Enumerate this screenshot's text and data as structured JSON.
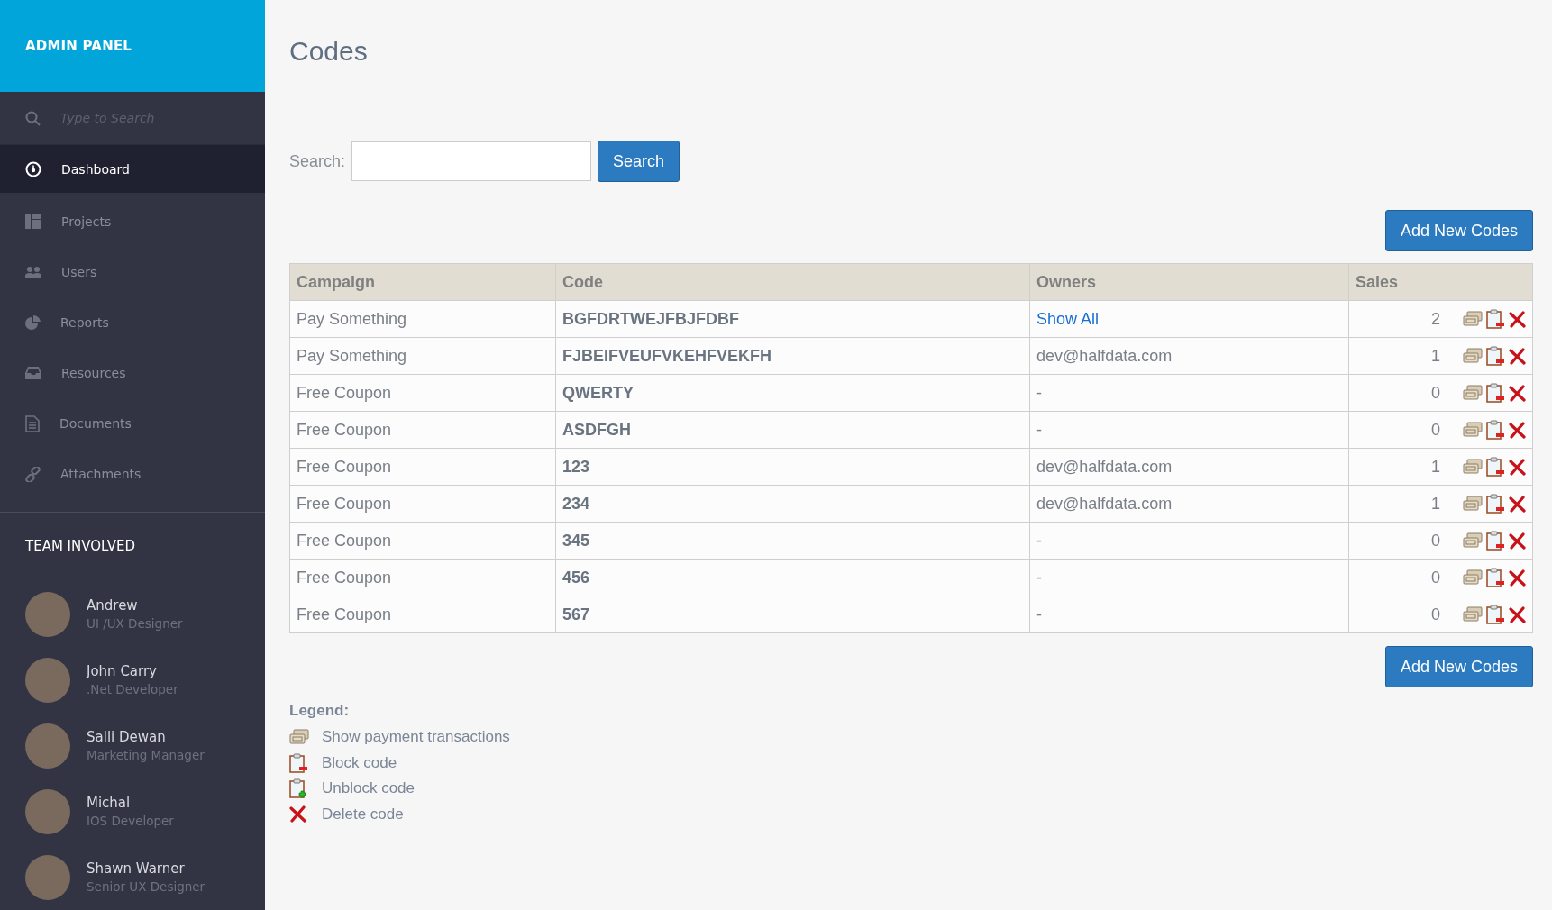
{
  "sidebar": {
    "brand": "ADMIN PANEL",
    "search": {
      "placeholder": "Type to Search"
    },
    "items": [
      {
        "label": "Dashboard",
        "selected": true
      },
      {
        "label": "Projects",
        "selected": false
      },
      {
        "label": "Users",
        "selected": false
      },
      {
        "label": "Reports",
        "selected": false
      },
      {
        "label": "Resources",
        "selected": false
      },
      {
        "label": "Documents",
        "selected": false
      },
      {
        "label": "Attachments",
        "selected": false
      }
    ],
    "team_title": "TEAM INVOLVED",
    "team": [
      {
        "name": "Andrew",
        "role": "UI /UX Designer"
      },
      {
        "name": "John Carry",
        "role": ".Net Developer"
      },
      {
        "name": "Salli Dewan",
        "role": "Marketing Manager"
      },
      {
        "name": "Michal",
        "role": "IOS Developer"
      },
      {
        "name": "Shawn Warner",
        "role": "Senior UX Designer"
      }
    ]
  },
  "page": {
    "title": "Codes",
    "search_label": "Search:",
    "search_button": "Search",
    "add_button_top": "Add New Codes",
    "add_button_bottom": "Add New Codes"
  },
  "table": {
    "columns": [
      "Campaign",
      "Code",
      "Owners",
      "Sales"
    ],
    "rows": [
      {
        "campaign": "Pay Something",
        "code": "BGFDRTWEJFBJFDBF",
        "owner": {
          "text": "Show All",
          "link": true
        },
        "sales": "2",
        "actions": [
          {
            "kind": "payments"
          },
          {
            "kind": "block"
          },
          {
            "kind": "delete"
          }
        ]
      },
      {
        "campaign": "Pay Something",
        "code": "FJBEIFVEUFVKEHFVEKFH",
        "owner": {
          "text": "dev@halfdata.com",
          "link": false
        },
        "sales": "1",
        "actions": [
          {
            "kind": "payments"
          },
          {
            "kind": "block"
          },
          {
            "kind": "delete"
          }
        ]
      },
      {
        "campaign": "Free Coupon",
        "code": "QWERTY",
        "owner": {
          "text": "-",
          "link": false
        },
        "sales": "0",
        "actions": [
          {
            "kind": "payments"
          },
          {
            "kind": "block"
          },
          {
            "kind": "delete"
          }
        ]
      },
      {
        "campaign": "Free Coupon",
        "code": "ASDFGH",
        "owner": {
          "text": "-",
          "link": false
        },
        "sales": "0",
        "actions": [
          {
            "kind": "payments"
          },
          {
            "kind": "block"
          },
          {
            "kind": "delete"
          }
        ]
      },
      {
        "campaign": "Free Coupon",
        "code": "123",
        "owner": {
          "text": "dev@halfdata.com",
          "link": false
        },
        "sales": "1",
        "actions": [
          {
            "kind": "payments"
          },
          {
            "kind": "block"
          },
          {
            "kind": "delete"
          }
        ]
      },
      {
        "campaign": "Free Coupon",
        "code": "234",
        "owner": {
          "text": "dev@halfdata.com",
          "link": false
        },
        "sales": "1",
        "actions": [
          {
            "kind": "payments"
          },
          {
            "kind": "block"
          },
          {
            "kind": "delete"
          }
        ]
      },
      {
        "campaign": "Free Coupon",
        "code": "345",
        "owner": {
          "text": "-",
          "link": false
        },
        "sales": "0",
        "actions": [
          {
            "kind": "payments"
          },
          {
            "kind": "block"
          },
          {
            "kind": "delete"
          }
        ]
      },
      {
        "campaign": "Free Coupon",
        "code": "456",
        "owner": {
          "text": "-",
          "link": false
        },
        "sales": "0",
        "actions": [
          {
            "kind": "payments"
          },
          {
            "kind": "block"
          },
          {
            "kind": "delete"
          }
        ]
      },
      {
        "campaign": "Free Coupon",
        "code": "567",
        "owner": {
          "text": "-",
          "link": false
        },
        "sales": "0",
        "actions": [
          {
            "kind": "payments"
          },
          {
            "kind": "block"
          },
          {
            "kind": "delete"
          }
        ]
      }
    ]
  },
  "legend": {
    "title": "Legend:",
    "items": [
      {
        "kind": "payments",
        "label": "Show payment transactions"
      },
      {
        "kind": "block",
        "label": "Block code"
      },
      {
        "kind": "unblock",
        "label": "Unblock code"
      },
      {
        "kind": "delete",
        "label": "Delete code"
      }
    ]
  }
}
